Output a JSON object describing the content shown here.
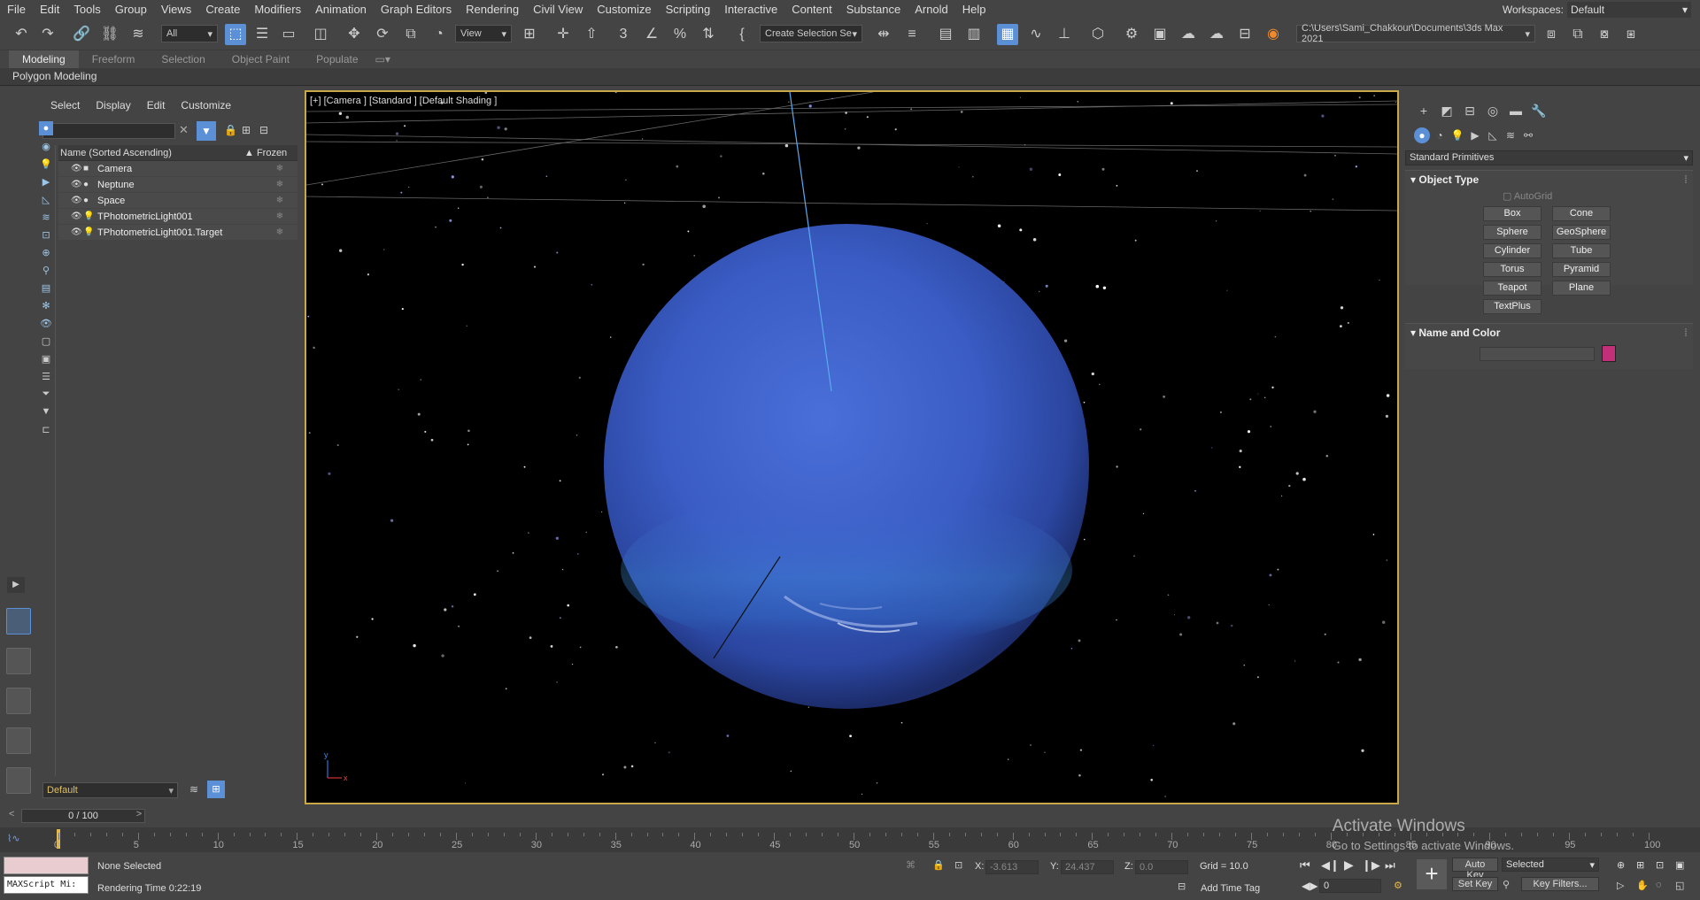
{
  "menu": [
    "File",
    "Edit",
    "Tools",
    "Group",
    "Views",
    "Create",
    "Modifiers",
    "Animation",
    "Graph Editors",
    "Rendering",
    "Civil View",
    "Customize",
    "Scripting",
    "Interactive",
    "Content",
    "Substance",
    "Arnold",
    "Help"
  ],
  "workspace": {
    "label": "Workspaces:",
    "value": "Default"
  },
  "toolbar": {
    "filter": "All",
    "ref_coord": "View",
    "named_selection": "Create Selection Se",
    "project_path": "C:\\Users\\Sami_Chakkour\\Documents\\3ds Max 2021"
  },
  "ribbon": {
    "tabs": [
      "Modeling",
      "Freeform",
      "Selection",
      "Object Paint",
      "Populate"
    ],
    "active": "Modeling",
    "sub": "Polygon Modeling"
  },
  "explorer": {
    "menu": [
      "Select",
      "Display",
      "Edit",
      "Customize"
    ],
    "col_name": "Name (Sorted Ascending)",
    "col_frozen": "▲ Frozen",
    "rows": [
      {
        "name": "Camera",
        "type": "camera-icon"
      },
      {
        "name": "Neptune",
        "type": "sphere-icon"
      },
      {
        "name": "Space",
        "type": "sphere-icon"
      },
      {
        "name": "TPhotometricLight001",
        "type": "light-icon"
      },
      {
        "name": "TPhotometricLight001.Target",
        "type": "light-icon"
      }
    ],
    "layer": "Default"
  },
  "viewport": {
    "label": "[+] [Camera ] [Standard ] [Default Shading ]",
    "bg": "#000000",
    "planet_color": "#3a5fc8"
  },
  "command_panel": {
    "category": "Standard Primitives",
    "object_type": {
      "title": "Object Type",
      "autogrid": "AutoGrid",
      "buttons": [
        "Box",
        "Cone",
        "Sphere",
        "GeoSphere",
        "Cylinder",
        "Tube",
        "Torus",
        "Pyramid",
        "Teapot",
        "Plane",
        "TextPlus"
      ]
    },
    "name_color": {
      "title": "Name and Color",
      "swatch": "#c2307a"
    }
  },
  "timeline": {
    "slider": "0 / 100",
    "ticks": [
      "0",
      "5",
      "10",
      "15",
      "20",
      "25",
      "30",
      "35",
      "40",
      "45",
      "50",
      "55",
      "60",
      "65",
      "70",
      "75",
      "80",
      "85",
      "90",
      "95",
      "100"
    ]
  },
  "status": {
    "maxscript": "MAXScript Mi:",
    "selection": "None Selected",
    "render_time": "Rendering Time  0:22:19",
    "x_label": "X:",
    "x": "-3.613",
    "y_label": "Y:",
    "y": "24.437",
    "z_label": "Z:",
    "z": "0.0",
    "grid": "Grid = 10.0",
    "add_time_tag": "Add Time Tag",
    "auto_key": "Auto Key",
    "selected": "Selected",
    "set_key": "Set Key",
    "key_filters": "Key Filters...",
    "frame": "0"
  },
  "activate": {
    "title": "Activate Windows",
    "sub": "Go to Settings to activate Windows."
  }
}
